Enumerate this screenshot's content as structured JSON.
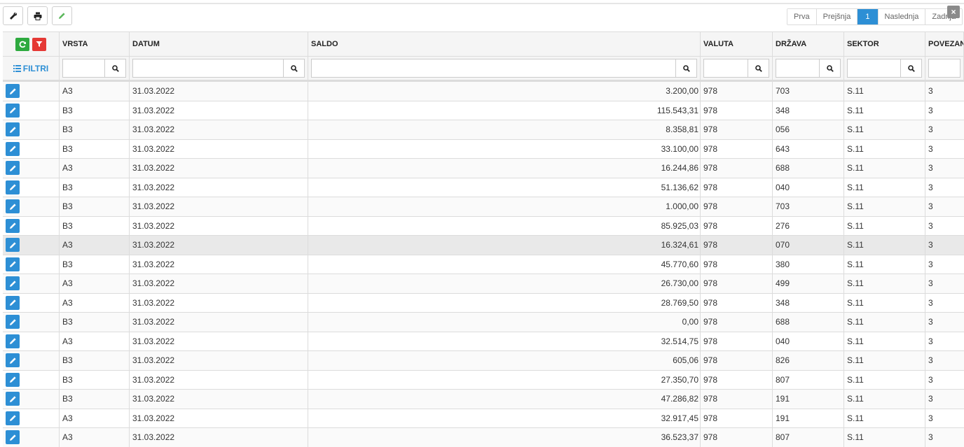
{
  "toolbar": {
    "buttons": [
      {
        "icon": "wrench-icon"
      },
      {
        "icon": "print-icon"
      },
      {
        "icon": "pencil-icon"
      }
    ]
  },
  "pager": {
    "first": "Prva",
    "prev": "Prejšnja",
    "current": "1",
    "next": "Naslednja",
    "last": "Zadnja"
  },
  "close": "×",
  "filters_label": "FILTRI",
  "columns": [
    "VRSTA",
    "DATUM",
    "SALDO",
    "VALUTA",
    "DRŽAVA",
    "SEKTOR",
    "POVEZAN"
  ],
  "rows": [
    [
      "A3",
      "31.03.2022",
      "3.200,00",
      "978",
      "703",
      "S.11",
      "3"
    ],
    [
      "B3",
      "31.03.2022",
      "115.543,31",
      "978",
      "348",
      "S.11",
      "3"
    ],
    [
      "B3",
      "31.03.2022",
      "8.358,81",
      "978",
      "056",
      "S.11",
      "3"
    ],
    [
      "B3",
      "31.03.2022",
      "33.100,00",
      "978",
      "643",
      "S.11",
      "3"
    ],
    [
      "A3",
      "31.03.2022",
      "16.244,86",
      "978",
      "688",
      "S.11",
      "3"
    ],
    [
      "B3",
      "31.03.2022",
      "51.136,62",
      "978",
      "040",
      "S.11",
      "3"
    ],
    [
      "B3",
      "31.03.2022",
      "1.000,00",
      "978",
      "703",
      "S.11",
      "3"
    ],
    [
      "B3",
      "31.03.2022",
      "85.925,03",
      "978",
      "276",
      "S.11",
      "3"
    ],
    [
      "A3",
      "31.03.2022",
      "16.324,61",
      "978",
      "070",
      "S.11",
      "3"
    ],
    [
      "B3",
      "31.03.2022",
      "45.770,60",
      "978",
      "380",
      "S.11",
      "3"
    ],
    [
      "A3",
      "31.03.2022",
      "26.730,00",
      "978",
      "499",
      "S.11",
      "3"
    ],
    [
      "A3",
      "31.03.2022",
      "28.769,50",
      "978",
      "348",
      "S.11",
      "3"
    ],
    [
      "B3",
      "31.03.2022",
      "0,00",
      "978",
      "688",
      "S.11",
      "3"
    ],
    [
      "A3",
      "31.03.2022",
      "32.514,75",
      "978",
      "040",
      "S.11",
      "3"
    ],
    [
      "B3",
      "31.03.2022",
      "605,06",
      "978",
      "826",
      "S.11",
      "3"
    ],
    [
      "B3",
      "31.03.2022",
      "27.350,70",
      "978",
      "807",
      "S.11",
      "3"
    ],
    [
      "B3",
      "31.03.2022",
      "47.286,82",
      "978",
      "191",
      "S.11",
      "3"
    ],
    [
      "A3",
      "31.03.2022",
      "32.917,45",
      "978",
      "191",
      "S.11",
      "3"
    ],
    [
      "A3",
      "31.03.2022",
      "36.523,37",
      "978",
      "807",
      "S.11",
      "3"
    ]
  ],
  "highlighted_row": 8,
  "colors": {
    "accent": "#2d8fd5",
    "refresh": "#2eaa3f",
    "filter_clear": "#e53935"
  }
}
